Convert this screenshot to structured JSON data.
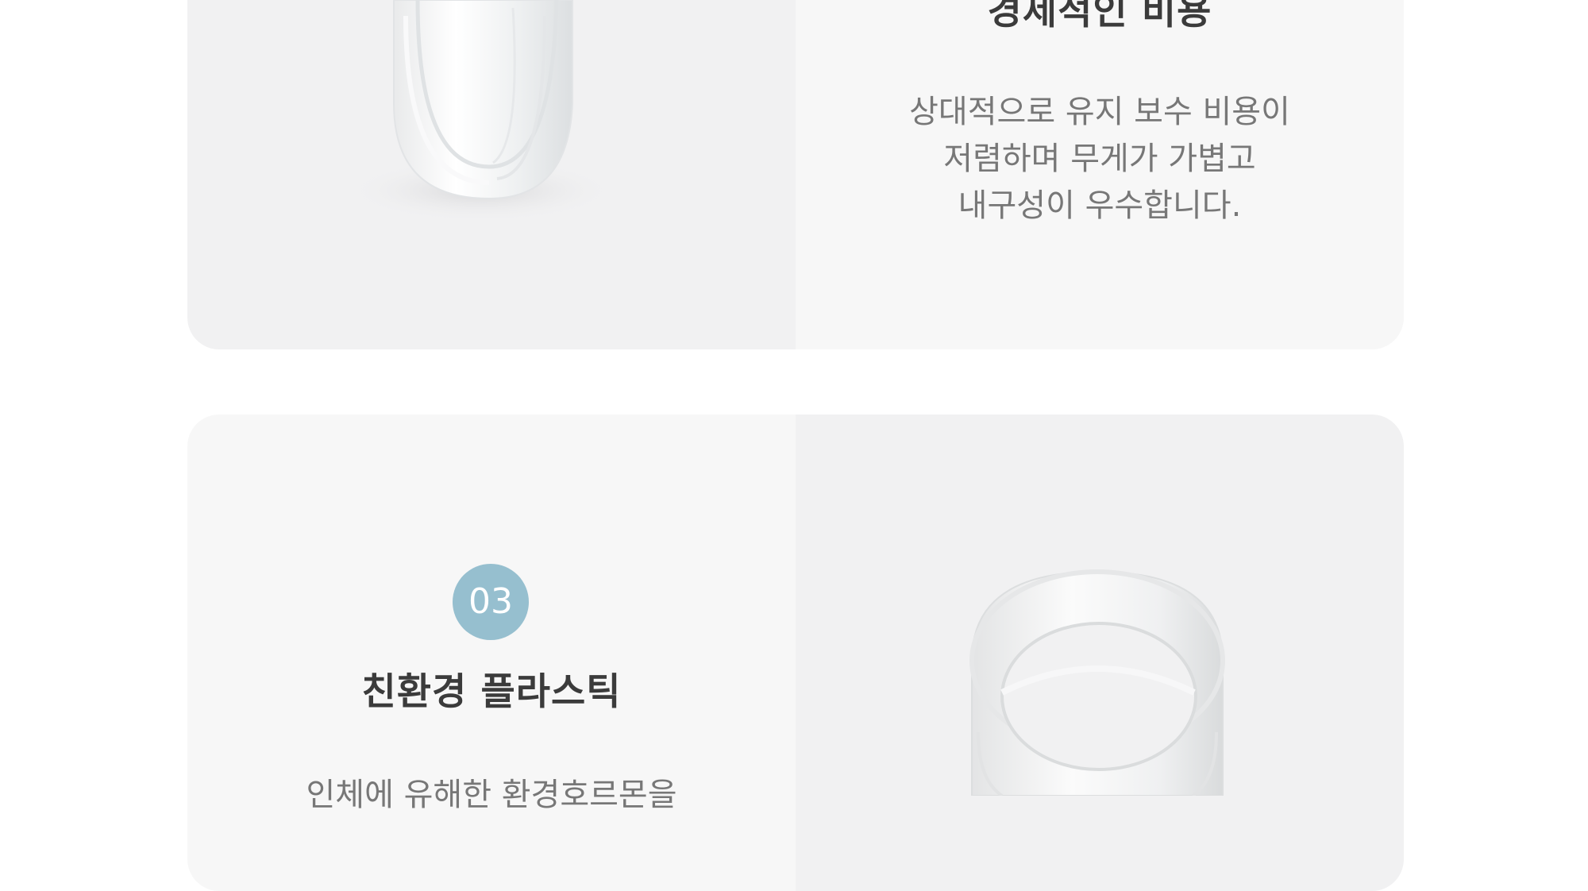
{
  "features": [
    {
      "title": "경제적인 비용",
      "description_lines": [
        "상대적으로 유지 보수 비용이",
        "저렴하며 무게가 가볍고",
        "내구성이 우수합니다."
      ],
      "image_icon": "plastic-ring-icon"
    },
    {
      "number": "03",
      "title": "친환경 플라스틱",
      "description_lines": [
        "인체에 유해한 환경호르몬을"
      ],
      "image_icon": "plastic-ring-icon"
    }
  ],
  "colors": {
    "badge": "#96bfcf",
    "image_panel": "#f1f1f2",
    "text_panel": "#f7f7f7",
    "title": "#3b3b3b",
    "description": "#777777"
  }
}
